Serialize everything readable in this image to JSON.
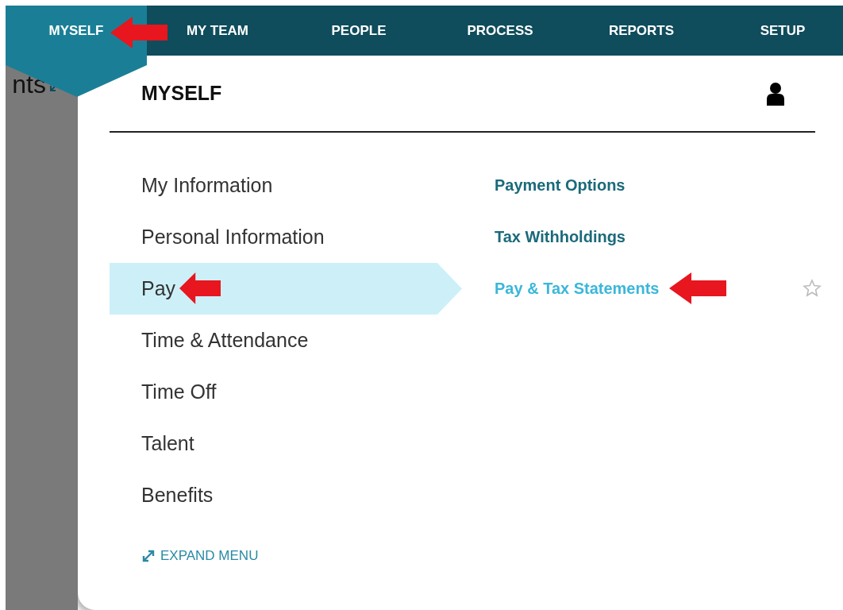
{
  "nav": {
    "tabs": [
      {
        "label": "MYSELF",
        "selected": true,
        "annotated": true
      },
      {
        "label": "MY TEAM",
        "selected": false,
        "annotated": false
      },
      {
        "label": "PEOPLE",
        "selected": false,
        "annotated": false
      },
      {
        "label": "PROCESS",
        "selected": false,
        "annotated": false
      },
      {
        "label": "REPORTS",
        "selected": false,
        "annotated": false
      },
      {
        "label": "SETUP",
        "selected": false,
        "annotated": false
      }
    ]
  },
  "background_page": {
    "title_fragment": "nts"
  },
  "menu": {
    "title": "MYSELF",
    "categories": [
      {
        "label": "My Information",
        "selected": false,
        "annotated": false
      },
      {
        "label": "Personal Information",
        "selected": false,
        "annotated": false
      },
      {
        "label": "Pay",
        "selected": true,
        "annotated": true
      },
      {
        "label": "Time & Attendance",
        "selected": false,
        "annotated": false
      },
      {
        "label": "Time Off",
        "selected": false,
        "annotated": false
      },
      {
        "label": "Talent",
        "selected": false,
        "annotated": false
      },
      {
        "label": "Benefits",
        "selected": false,
        "annotated": false
      }
    ],
    "links": [
      {
        "label": "Payment Options",
        "selected": false,
        "annotated": false
      },
      {
        "label": "Tax Withholdings",
        "selected": false,
        "annotated": false
      },
      {
        "label": "Pay & Tax Statements",
        "selected": true,
        "annotated": true
      }
    ],
    "expand_label": "EXPAND MENU"
  }
}
